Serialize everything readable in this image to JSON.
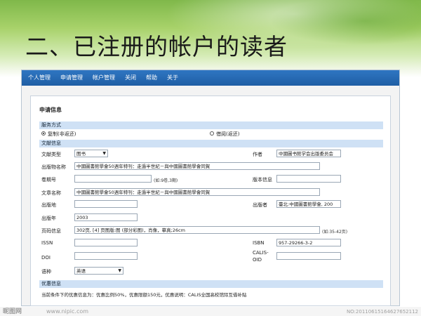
{
  "slide": {
    "title": "二、已注册的帐户的读者"
  },
  "menu": {
    "items": [
      "个人管理",
      "申请管理",
      "帐户管理",
      "关闭",
      "帮助",
      "关于"
    ]
  },
  "form": {
    "panel_title": "申请信息",
    "service": {
      "section": "服务方式",
      "option_copy": "复制(非返还)",
      "option_loan": "借阅(返还)",
      "selected": "copy"
    },
    "doc": {
      "section": "文献信息",
      "doc_type_label": "文献类型",
      "doc_type_value": "图书",
      "author_label": "作者",
      "author_value": "中國圖书館学会出版委员会",
      "pub_name_label": "出版物名称",
      "pub_name_value": "中國圖書館學會50週年特刊：走過半世紀－與中國圖書館學會同賀",
      "volume_label": "卷期号",
      "volume_value": "",
      "volume_hint": "(如:9卷,3期)",
      "edition_label": "版本信息",
      "edition_value": "",
      "title_label": "文章名称",
      "title_value": "中國圖書館學會50週年特刊：走過半世紀－與中國圖書館學會同賀",
      "place_label": "出版地",
      "place_value": "",
      "publisher_label": "出版者",
      "publisher_value": "臺北:中國圖書館學會, 200",
      "year_label": "出版年",
      "year_value": "2003",
      "pages_label": "页码信息",
      "pages_value": "302页, [4] 页图版:图 (部分彩图)，肖像，摹真;26cm",
      "pages_hint": "(如:35-42页)",
      "issn_label": "ISSN",
      "issn_value": "",
      "isbn_label": "ISBN",
      "isbn_value": "957-29266-3-2",
      "doi_label": "DOI",
      "doi_value": "",
      "calis_label_1": "CALIS-",
      "calis_label_2": "OID",
      "calis_value": "",
      "lang_label": "语种",
      "lang_value": "英语"
    },
    "offer": {
      "section": "优惠信息",
      "text": "当前条件下的优惠信息为：优惠比例50%，优惠限额150元，优惠说明：CALIS全国高校馆际互借补贴"
    }
  },
  "watermark": {
    "left": "昵图网",
    "url": "www.nipic.com",
    "right": "NO:20110615164627652112"
  }
}
